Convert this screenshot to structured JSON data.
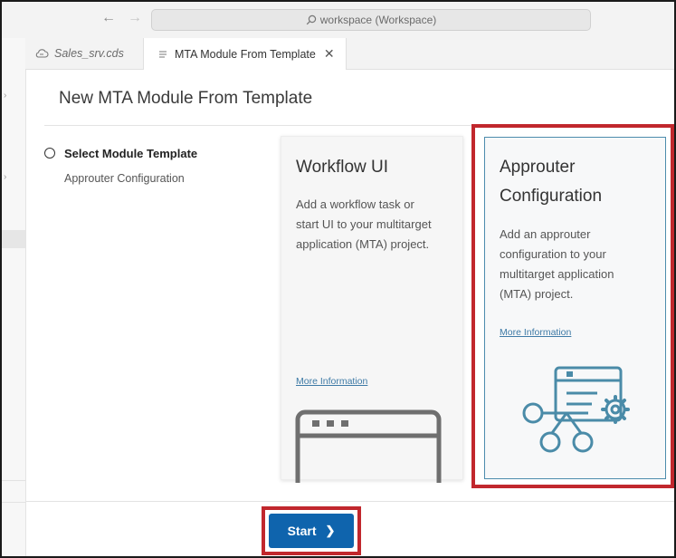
{
  "titlebar": {
    "back_glyph": "←",
    "forward_glyph": "→",
    "search_text": "workspace (Workspace)"
  },
  "tabs": [
    {
      "label": "Sales_srv.cds",
      "icon": "cloud-icon",
      "active": false
    },
    {
      "label": "MTA Module From Template",
      "icon": "lines-icon",
      "active": true,
      "close_glyph": "✕"
    }
  ],
  "wizard": {
    "title": "New MTA Module From Template",
    "step_title": "Select Module Template",
    "step_subtitle": "Approuter Configuration"
  },
  "cards": [
    {
      "title": "Workflow UI",
      "description": [
        "Add a workflow task or",
        "start UI to your multitarget",
        "application (MTA) project."
      ],
      "link": "More Information",
      "selected": false
    },
    {
      "title": [
        "Approuter",
        "Configuration"
      ],
      "description": [
        "Add an approuter",
        "configuration to your",
        "multitarget application",
        "(MTA) project."
      ],
      "link": "More Information",
      "selected": true
    }
  ],
  "footer": {
    "start_label": "Start",
    "start_chevron": "❯"
  },
  "colors": {
    "accent": "#0f64ad",
    "highlight": "#c1272d",
    "icon_teal": "#4a8ba8",
    "icon_gray": "#6f6f6f"
  }
}
